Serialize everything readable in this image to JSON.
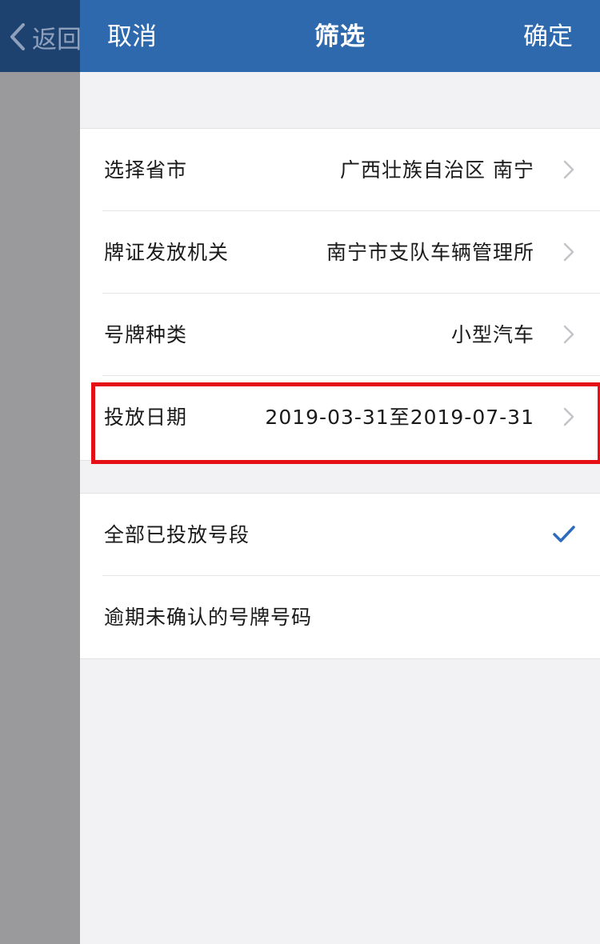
{
  "background_page": {
    "back_label": "返回"
  },
  "header": {
    "cancel_label": "取消",
    "title": "筛选",
    "confirm_label": "确定"
  },
  "filters": [
    {
      "label": "选择省市",
      "value": "广西壮族自治区 南宁",
      "icon": "chevron-right-icon"
    },
    {
      "label": "牌证发放机关",
      "value": "南宁市支队车辆管理所",
      "icon": "chevron-right-icon"
    },
    {
      "label": "号牌种类",
      "value": "小型汽车",
      "icon": "chevron-right-icon"
    },
    {
      "label": "投放日期",
      "value": "2019-03-31至2019-07-31",
      "icon": "chevron-right-icon"
    }
  ],
  "options": [
    {
      "label": "全部已投放号段",
      "selected": true,
      "icon": "checkmark-icon"
    },
    {
      "label": "逾期未确认的号牌号码",
      "selected": false
    }
  ],
  "colors": {
    "header_bg": "#2e68ad",
    "check": "#2e6bbd",
    "highlight": "#e50f16"
  }
}
